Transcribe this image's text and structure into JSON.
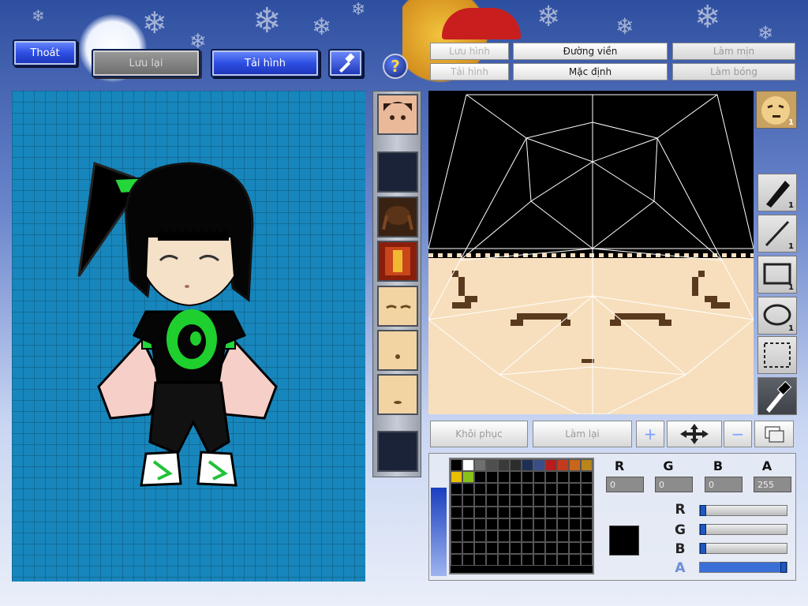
{
  "top_buttons": {
    "exit": "Thoát",
    "save": "Lưu lại",
    "reload": "Tải hình",
    "tool_icon": "hammer-icon"
  },
  "help_icon": "question-icon",
  "tabs": {
    "save_image": "Lưu hình",
    "outline": "Đường viền",
    "smooth": "Làm mịn",
    "load_image": "Tải hình",
    "default": "Mặc định",
    "shading": "Làm bóng"
  },
  "actions": {
    "restore": "Khôi phục",
    "redo": "Làm lại"
  },
  "tools": {
    "pen_count": "1",
    "line_count": "1",
    "rect_count": "1",
    "ellipse_count": "1"
  },
  "channels": {
    "r_label": "R",
    "g_label": "G",
    "b_label": "B",
    "a_label": "A",
    "r_value": "0",
    "g_value": "0",
    "b_value": "0",
    "a_value": "255"
  },
  "sliders": {
    "r_level": 0.0,
    "g_level": 0.0,
    "b_level": 0.0,
    "a_level": 1.0
  },
  "palette": [
    "#000000",
    "#ffffff",
    "#6f6f6f",
    "#4f4f4f",
    "#3a3a3a",
    "#2c2c2c",
    "#1e2f57",
    "#3a4f8a",
    "#b81c1c",
    "#c43a1c",
    "#c8661c",
    "#b8861c",
    "#e8c000",
    "#88c218"
  ],
  "selected_color": "#000000",
  "face_preview_label": "1",
  "colors": {
    "accent": "#2e4fe3",
    "canvas": "#1786bc"
  }
}
